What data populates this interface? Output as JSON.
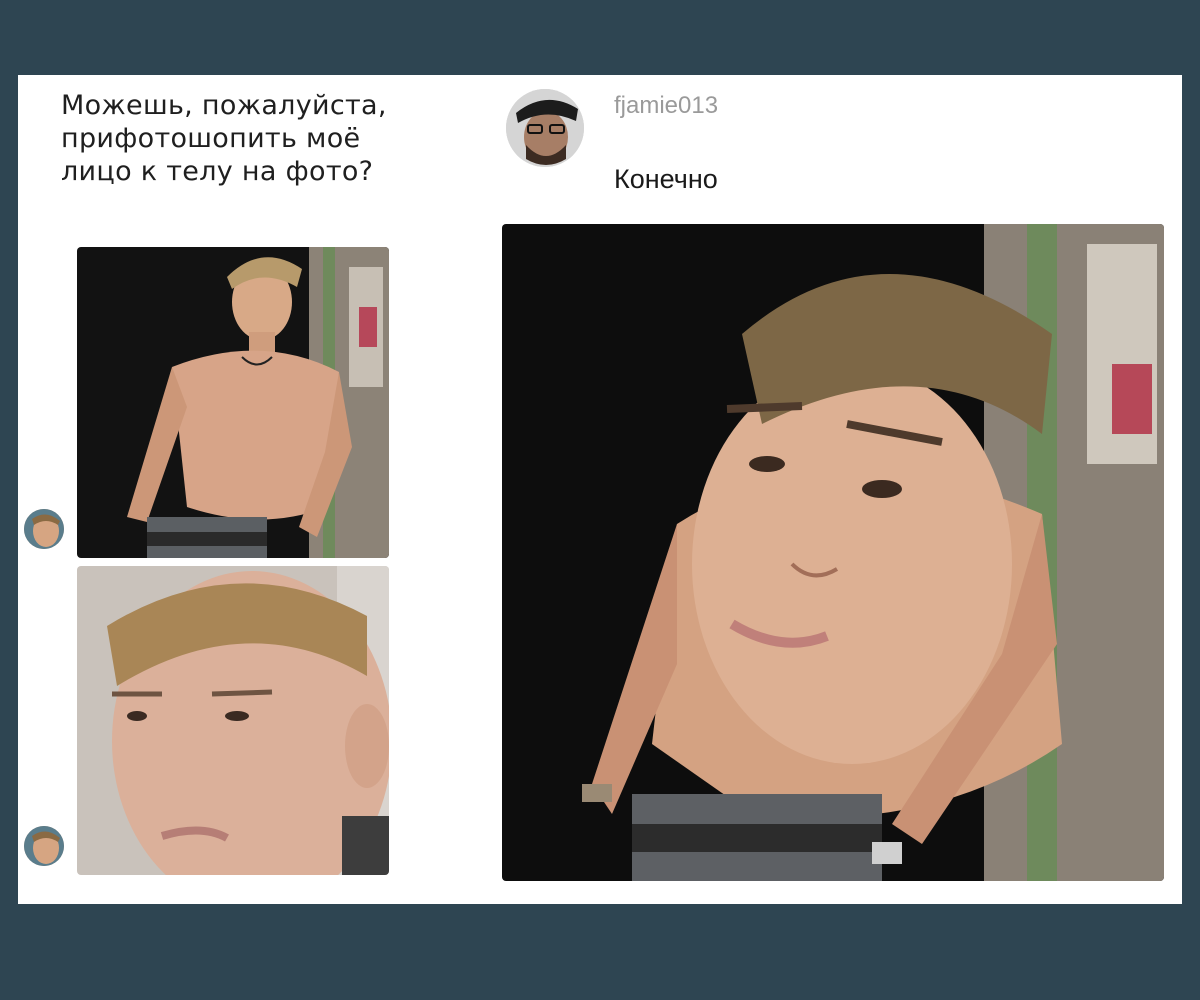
{
  "left_message": {
    "text": "Можешь, пожалуйста,\nприфотошопить моё\nлицо к телу на фото?",
    "images": [
      {
        "description_icon": "shirtless-body-photo-icon"
      },
      {
        "description_icon": "face-selfie-photo-icon"
      }
    ],
    "avatar_icon": "user-avatar-icon"
  },
  "reply": {
    "username": "fjamie013",
    "text": "Конечно",
    "avatar_icon": "bearded-man-avatar-icon",
    "image_icon": "edited-face-on-body-photo-icon"
  },
  "colors": {
    "background": "#2e4552",
    "panel": "#ffffff",
    "username": "#9a9a9a",
    "text": "#1a1a1a"
  }
}
